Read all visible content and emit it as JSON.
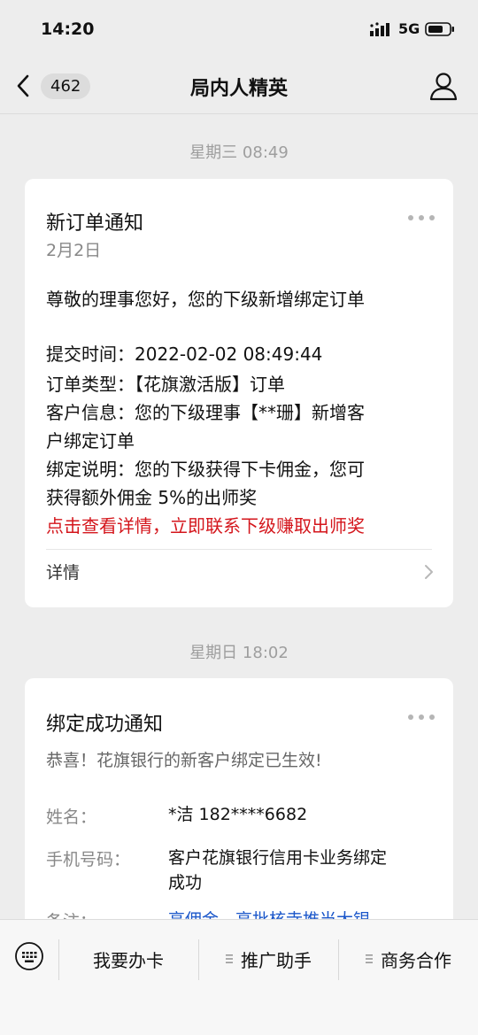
{
  "status_bar": {
    "time": "14:20",
    "network": "5G"
  },
  "nav": {
    "back_count": "462",
    "title": "局内人精英"
  },
  "messages": [
    {
      "timestamp": "星期三 08:49",
      "title": "新订单通知",
      "date": "2月2日",
      "lines": [
        "尊敬的理事您好，您的下级新增绑定订单",
        "提交时间：2022-02-02 08:49:44",
        "订单类型：【花旗激活版】订单",
        "客户信息：您的下级理事【**珊】新增客",
        "户绑定订单",
        "绑定说明：您的下级获得下卡佣金，您可",
        "获得额外佣金 5%的出师奖"
      ],
      "highlight": "点击查看详情，立即联系下级赚取出师奖",
      "highlight_color": "#d4161c",
      "detail_label": "详情"
    },
    {
      "timestamp": "星期日 18:02",
      "title": "绑定成功通知",
      "subtitle": "恭喜！花旗银行的新客户绑定已生效!",
      "fields": [
        {
          "label": "姓名：",
          "value": "*洁 182****6682"
        },
        {
          "label": "手机号码：",
          "value_line1": "客户花旗银行信用卡业务绑定",
          "value_line2": "成功"
        },
        {
          "label": "备注：",
          "value": "高佣金，高批核寺推当大银"
        }
      ]
    }
  ],
  "bottom_menu": {
    "items": [
      "我要办卡",
      "推广助手",
      "商务合作"
    ]
  },
  "colors": {
    "background": "#ededed",
    "card": "#ffffff",
    "alert_red": "#d4161c",
    "link_blue": "#1a56c9"
  }
}
